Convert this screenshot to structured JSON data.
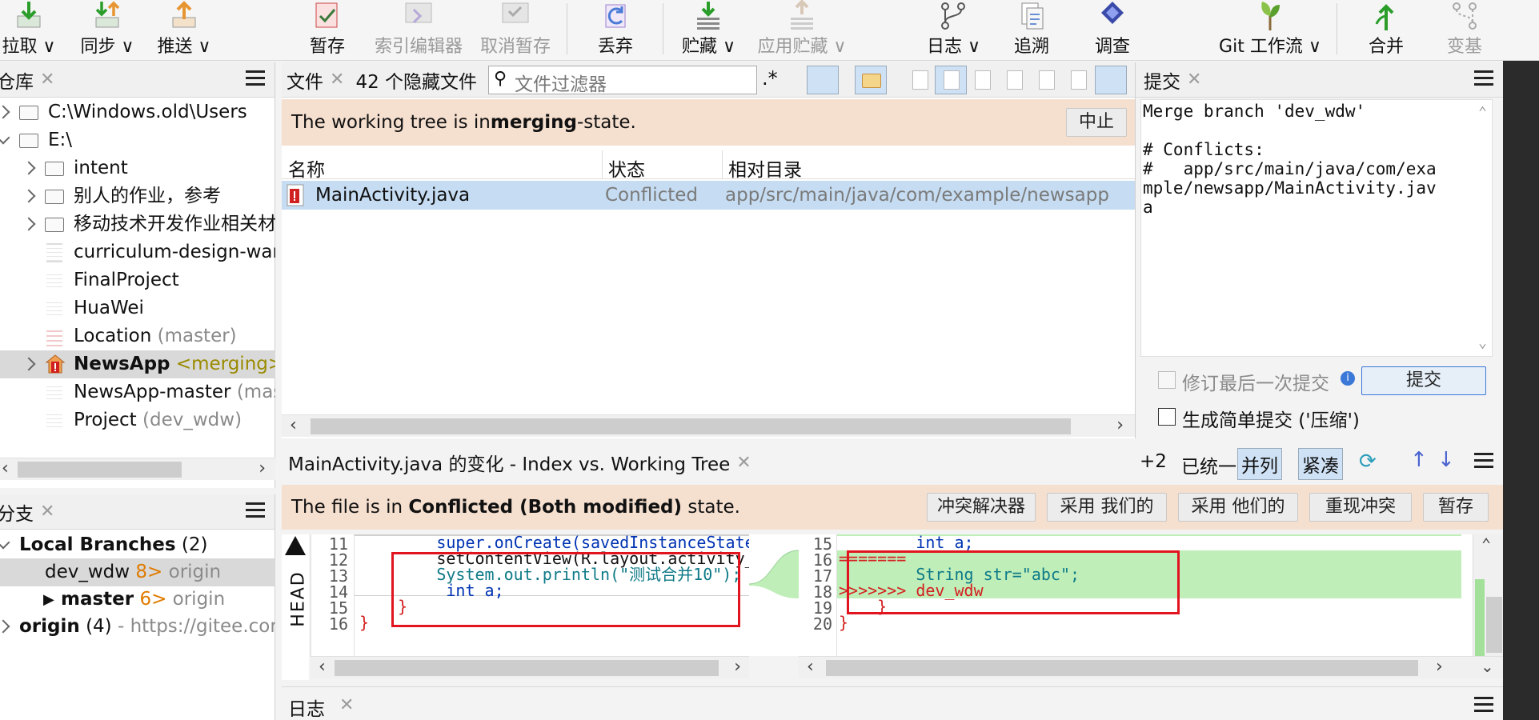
{
  "toolbar": {
    "pull": "拉取 ∨",
    "sync": "同步 ∨",
    "push": "推送 ∨",
    "stage": "暂存",
    "index_editor": "索引编辑器",
    "unstage": "取消暂存",
    "discard": "丢弃",
    "stash": "贮藏 ∨",
    "apply_stash": "应用贮藏 ∨",
    "log": "日志 ∨",
    "blame": "追溯",
    "investigate": "调查",
    "git_flow": "Git 工作流 ∨",
    "merge": "合并",
    "rebase": "变基"
  },
  "repos": {
    "title": "仓库",
    "items": [
      {
        "label": "C:\\Windows.old\\Users",
        "extra": ""
      },
      {
        "label": "E:\\",
        "extra": ""
      },
      {
        "label": "intent",
        "extra": ""
      },
      {
        "label": "别人的作业，参考",
        "extra": ""
      },
      {
        "label": "移动技术开发作业相关材料",
        "extra": ""
      },
      {
        "label": "curriculum-design-warehouse",
        "extra": ""
      },
      {
        "label": "FinalProject",
        "extra": ""
      },
      {
        "label": "HuaWei",
        "extra": ""
      },
      {
        "label": "Location",
        "extra": "(master)"
      },
      {
        "label": "NewsApp",
        "extra": "<merging>"
      },
      {
        "label": "NewsApp-master",
        "extra": "(master)"
      },
      {
        "label": "Project",
        "extra": "(dev_wdw)"
      }
    ]
  },
  "branches": {
    "title": "分支",
    "local_label": "Local Branches",
    "local_count": "(2)",
    "items": [
      {
        "name": "dev_wdw",
        "ahead": "8>",
        "remote": "origin"
      },
      {
        "name": "master",
        "ahead": "6>",
        "remote": "origin"
      }
    ],
    "origin_label": "origin",
    "origin_count": "(4)",
    "origin_url": "- https://gitee.com"
  },
  "files": {
    "tab": "文件",
    "hidden": "42 个隐藏文件",
    "filter_placeholder": "文件过滤器",
    "regex": ".*",
    "banner_prefix": "The working tree is in ",
    "banner_state": "merging",
    "banner_suffix": "-state.",
    "abort_btn": "中止",
    "columns": [
      "名称",
      "状态",
      "相对目录"
    ],
    "rows": [
      {
        "name": "MainActivity.java",
        "status": "Conflicted",
        "dir": "app/src/main/java/com/example/newsapp"
      }
    ]
  },
  "commit": {
    "title": "提交",
    "message_lines": [
      "Merge branch 'dev_wdw'",
      "",
      "# Conflicts:",
      "#   app/src/main/java/com/exa",
      "mple/newsapp/MainActivity.jav",
      "a"
    ],
    "amend": "修订最后一次提交",
    "commit_btn": "提交",
    "squash": "生成简单提交 ('压缩')"
  },
  "diff": {
    "title": "MainActivity.java 的变化 - Index vs. Working Tree",
    "plus": "+2",
    "unified": "已统一",
    "side_by_side": "并列",
    "compact": "紧凑",
    "banner_prefix": "The file is in ",
    "banner_state": "Conflicted (Both modified)",
    "banner_suffix": " state.",
    "buttons": [
      "冲突解决器",
      "采用 我们的",
      "采用 他们的",
      "重现冲突",
      "暂存"
    ],
    "head_label": "HEAD",
    "left": {
      "lines": [
        "11",
        "12",
        "13",
        "14",
        "15",
        "16"
      ],
      "code": [
        "        super.onCreate(savedInstanceState);",
        "        setContentView(R.layout.activity_main);",
        "        System.out.println(\"测试合并10\");",
        "         int a;",
        "    }",
        "}"
      ]
    },
    "right": {
      "lines": [
        "15",
        "16",
        "17",
        "18",
        "19",
        "20"
      ],
      "code": [
        "        int a;",
        "=======",
        "        String str=\"abc\";",
        ">>>>>>> dev_wdw",
        "    }",
        "}"
      ]
    }
  },
  "log": {
    "title": "日志"
  }
}
